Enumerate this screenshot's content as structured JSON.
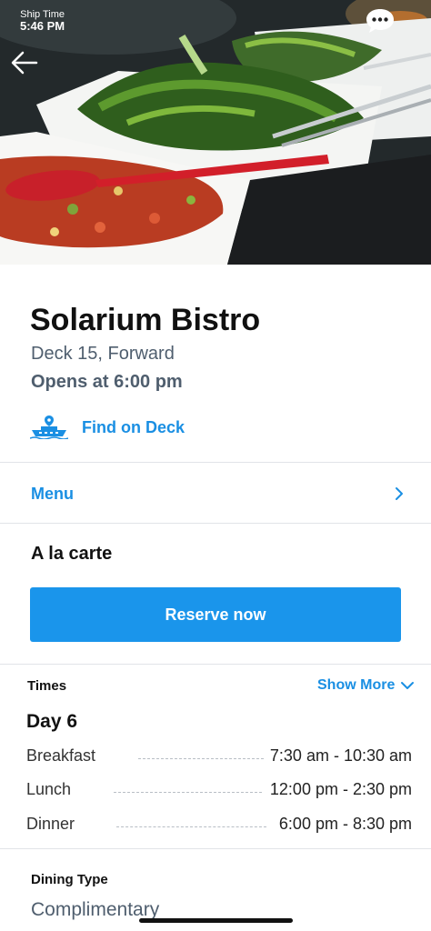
{
  "status": {
    "ship_time_label": "Ship Time",
    "ship_time": "5:46 PM"
  },
  "venue": {
    "name": "Solarium Bistro",
    "location": "Deck 15, Forward",
    "opens": "Opens at 6:00 pm",
    "find_on_deck": "Find on Deck"
  },
  "menu": {
    "label": "Menu"
  },
  "service": {
    "style": "A la carte",
    "reserve_label": "Reserve now"
  },
  "times": {
    "label": "Times",
    "show_more": "Show More",
    "day": "Day 6",
    "meals": [
      {
        "name": "Breakfast",
        "time": "7:30 am - 10:30 am"
      },
      {
        "name": "Lunch",
        "time": "12:00 pm - 2:30 pm"
      },
      {
        "name": "Dinner",
        "time": "6:00 pm - 8:30 pm"
      }
    ]
  },
  "dining": {
    "label": "Dining Type",
    "value": "Complimentary"
  },
  "icons": {
    "back": "arrow-left-icon",
    "chat": "chat-bubble-icon",
    "find": "ship-location-icon",
    "chevron": "chevron-right-icon",
    "show_more": "chevron-down-icon"
  },
  "colors": {
    "accent": "#1a8fe3",
    "button": "#1a95eb",
    "muted_text": "#4f5e6e"
  }
}
